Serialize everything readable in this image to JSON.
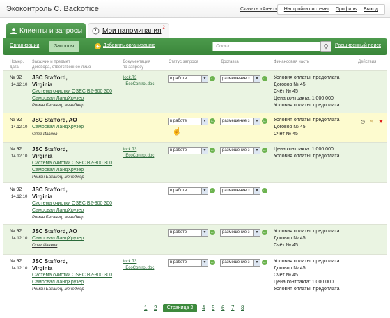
{
  "app": {
    "title": "Экоконтроль С. Backoffice"
  },
  "header": {
    "agent_link": "Сказать «Агент»",
    "links": [
      "Настройки системы",
      "Профиль",
      "Выход"
    ]
  },
  "tabs": [
    {
      "label": "Клиенты и запросы",
      "icon": "person-icon",
      "active": true
    },
    {
      "label": "Мои напоминания",
      "icon": "clock-icon",
      "badge": "2",
      "active": false
    }
  ],
  "toolbar": {
    "orgs": "Организации",
    "requests": "Запросы",
    "add_org": "Добавить организацию",
    "search_placeholder": "Поиск",
    "advanced_search": "Расширенный поиск"
  },
  "columns": {
    "number_date": [
      "Номер,",
      "дата"
    ],
    "client": [
      "Заказчик и предмет",
      "договора, ответственное лицо"
    ],
    "docs": [
      "Документация",
      "по запросу"
    ],
    "status": "Статус запроса",
    "delivery": "Доставка",
    "finance": "Финансовая часть",
    "actions": "Действия"
  },
  "rows": [
    {
      "num": "№ 92",
      "date": "14.12.10",
      "name": [
        "JSC Stafford,",
        "Virginia"
      ],
      "links": [
        "Система очистки OSEC B2-300 300",
        "Самосвал ЛандХрузер"
      ],
      "manager": "Роман Баханец, менеджер",
      "manager_u": false,
      "docs": [
        "lock.T3",
        "_EcoControl.doc"
      ],
      "status": "в работе",
      "delivery": "размещение з",
      "finance": [
        "Условия оплаты: предоплата",
        "Договор № 45",
        "Счёт № 45",
        "Цена контракта: 1 000 000",
        "Условия оплаты: предоплата"
      ],
      "style": "green"
    },
    {
      "num": "№ 92",
      "date": "14.12.10",
      "name": [
        "JSC Stafford, AO"
      ],
      "links": [
        "Самосвал ЛандХрузер"
      ],
      "manager": "Олег Иванов",
      "manager_u": true,
      "docs": [],
      "status": "в работе",
      "delivery": "размещение з",
      "finance": [
        "Условия оплаты: предоплата",
        "Договор № 45",
        "Счёт № 45"
      ],
      "style": "yellow"
    },
    {
      "num": "№ 92",
      "date": "14.12.10",
      "name": [
        "JSC Stafford,",
        "Virginia"
      ],
      "links": [
        "Система очистки OSEC B2-300 300",
        "Самосвал ЛандХрузер"
      ],
      "manager": "Роман Баханец, менеджер",
      "manager_u": false,
      "docs": [
        "lock.T3",
        "_EcoControl.doc"
      ],
      "status": "в работе",
      "delivery": "размещение з",
      "finance": [
        "Цена контракта: 1 000 000",
        "Условия оплаты: предоплата"
      ],
      "style": "green"
    },
    {
      "num": "№ 92",
      "date": "14.12.10",
      "name": [
        "JSC Stafford,",
        "Virginia"
      ],
      "links": [
        "Система очистки OSEC B2-300 300",
        "Самосвал ЛандХрузер"
      ],
      "manager": "Роман Баханец, менеджер",
      "manager_u": false,
      "docs": [],
      "status": "в работе",
      "delivery": "размещение з",
      "finance": [],
      "style": "white"
    },
    {
      "num": "№ 92",
      "date": "14.12.10",
      "name": [
        "JSC Stafford, AO"
      ],
      "links": [
        "Самосвал ЛандХрузер"
      ],
      "manager": "Олег Иванов",
      "manager_u": true,
      "docs": [],
      "status": "в работе",
      "delivery": "размещение з",
      "finance": [
        "Условия оплаты: предоплата",
        "Договор № 45",
        "Счёт № 45"
      ],
      "style": "green"
    },
    {
      "num": "№ 92",
      "date": "14.12.10",
      "name": [
        "JSC Stafford,",
        "Virginia"
      ],
      "links": [
        "Система очистки OSEC B2-300 300",
        "Самосвал ЛандХрузер"
      ],
      "manager": "Роман Баханец, менеджер",
      "manager_u": false,
      "docs": [
        "lock.T3",
        "_EcoControl.doc"
      ],
      "status": "в работе",
      "delivery": "размещение з",
      "finance": [
        "Условия оплаты: предоплата",
        "Договор № 45",
        "Счёт № 45",
        "Цена контракта: 1 000 000",
        "Условия оплаты: предоплата"
      ],
      "style": "white"
    }
  ],
  "actions_row2": [
    "clock-icon",
    "edit-icon",
    "delete-icon"
  ],
  "pager": {
    "pages": [
      "1",
      "2",
      "4",
      "5",
      "6",
      "7",
      "8"
    ],
    "current": "Страница 3"
  },
  "colors": {
    "accent": "#3d8a3d",
    "row_green": "#eaf4e2",
    "row_yellow": "#fdfbcf"
  }
}
